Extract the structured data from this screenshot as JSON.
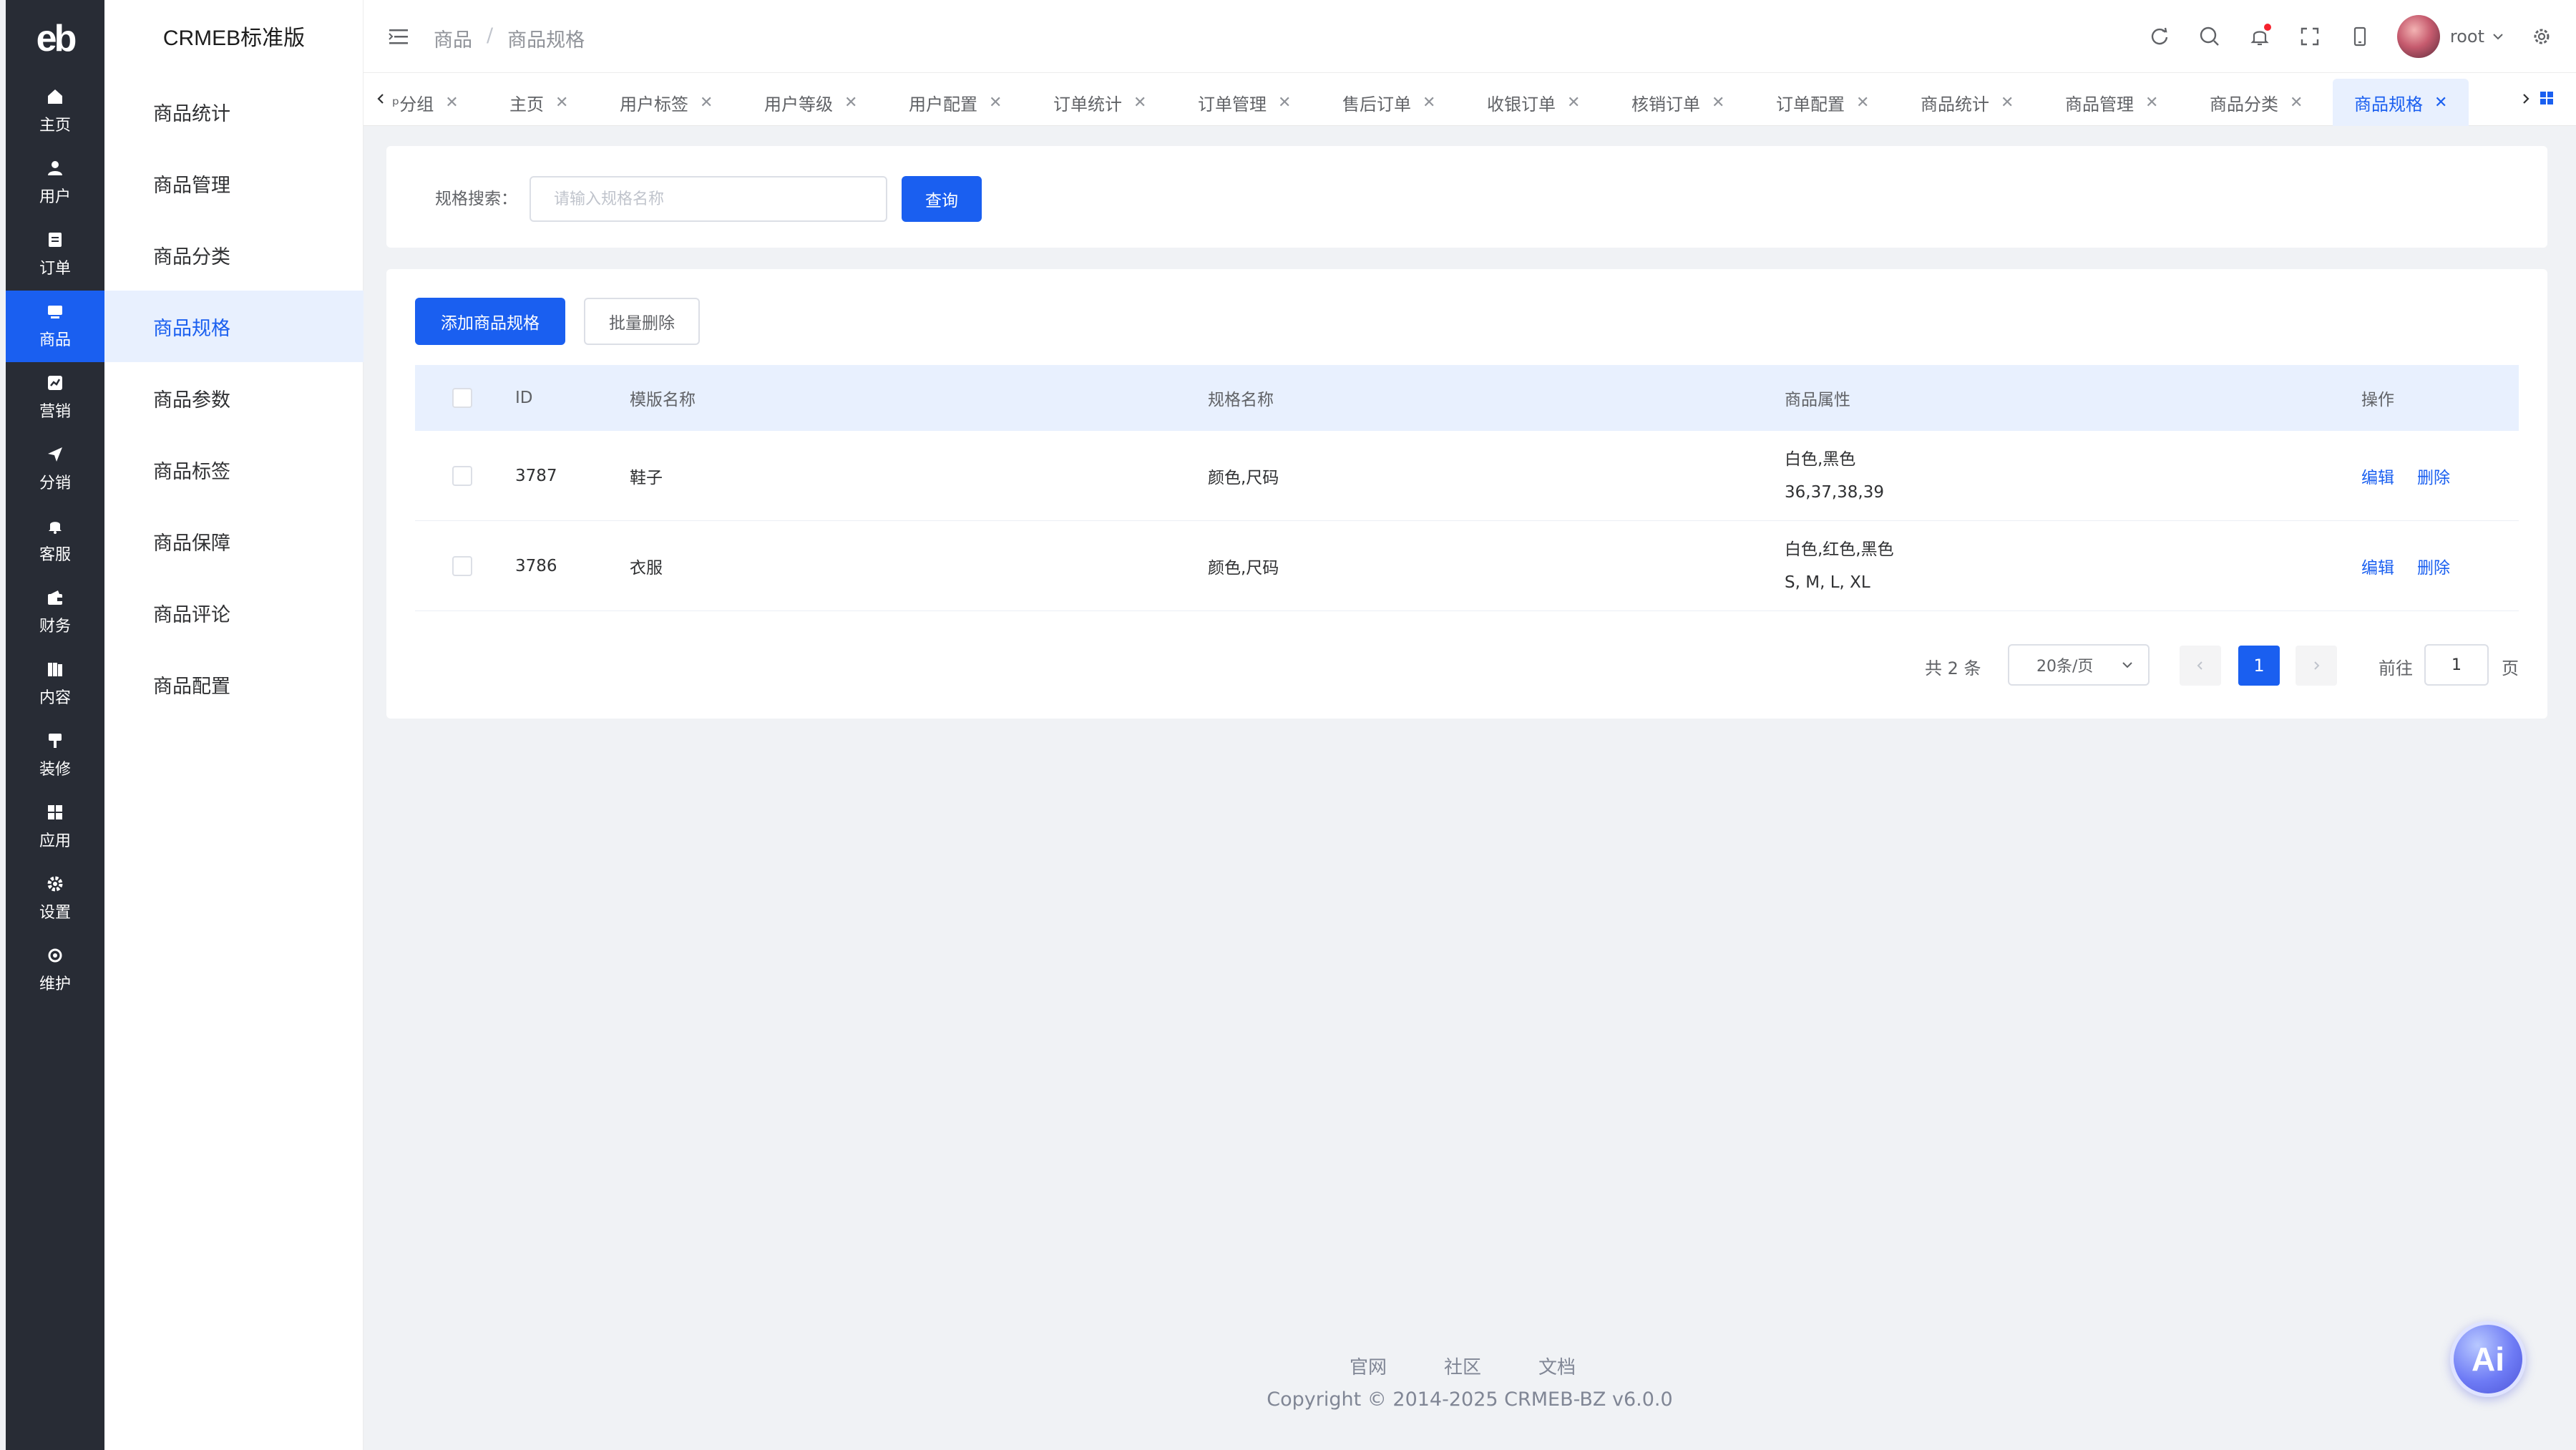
{
  "brand": {
    "logo_text": "eb",
    "title": "CRMEB标准版"
  },
  "rail": {
    "items": [
      {
        "label": "主页",
        "icon": "home-icon"
      },
      {
        "label": "用户",
        "icon": "user-icon"
      },
      {
        "label": "订单",
        "icon": "order-icon"
      },
      {
        "label": "商品",
        "icon": "product-icon",
        "active": true
      },
      {
        "label": "营销",
        "icon": "marketing-icon"
      },
      {
        "label": "分销",
        "icon": "distribution-icon"
      },
      {
        "label": "客服",
        "icon": "service-icon"
      },
      {
        "label": "财务",
        "icon": "finance-icon"
      },
      {
        "label": "内容",
        "icon": "content-icon"
      },
      {
        "label": "装修",
        "icon": "decorate-icon"
      },
      {
        "label": "应用",
        "icon": "apps-icon"
      },
      {
        "label": "设置",
        "icon": "settings-icon"
      },
      {
        "label": "维护",
        "icon": "maintain-icon"
      }
    ]
  },
  "subnav": {
    "items": [
      {
        "label": "商品统计"
      },
      {
        "label": "商品管理"
      },
      {
        "label": "商品分类"
      },
      {
        "label": "商品规格",
        "active": true
      },
      {
        "label": "商品参数"
      },
      {
        "label": "商品标签"
      },
      {
        "label": "商品保障"
      },
      {
        "label": "商品评论"
      },
      {
        "label": "商品配置"
      }
    ]
  },
  "header": {
    "breadcrumb": [
      "商品",
      "商品规格"
    ],
    "breadcrumb_sep": "/",
    "username": "root"
  },
  "tabs": [
    {
      "label": "ᵖ分组"
    },
    {
      "label": "主页"
    },
    {
      "label": "用户标签"
    },
    {
      "label": "用户等级"
    },
    {
      "label": "用户配置"
    },
    {
      "label": "订单统计"
    },
    {
      "label": "订单管理"
    },
    {
      "label": "售后订单"
    },
    {
      "label": "收银订单"
    },
    {
      "label": "核销订单"
    },
    {
      "label": "订单配置"
    },
    {
      "label": "商品统计"
    },
    {
      "label": "商品管理"
    },
    {
      "label": "商品分类"
    },
    {
      "label": "商品规格",
      "active": true
    }
  ],
  "search": {
    "label": "规格搜索：",
    "placeholder": "请输入规格名称",
    "value": "",
    "button": "查询"
  },
  "toolbar": {
    "add": "添加商品规格",
    "batch_delete": "批量删除"
  },
  "table": {
    "columns": [
      "ID",
      "模版名称",
      "规格名称",
      "商品属性",
      "操作"
    ],
    "rows": [
      {
        "id": "3787",
        "template": "鞋子",
        "spec": "颜色,尺码",
        "attr_line1": "白色,黑色",
        "attr_line2": "36,37,38,39",
        "edit": "编辑",
        "delete": "删除"
      },
      {
        "id": "3786",
        "template": "衣服",
        "spec": "颜色,尺码",
        "attr_line1": "白色,红色,黑色",
        "attr_line2": "S, M, L, XL",
        "edit": "编辑",
        "delete": "删除"
      }
    ]
  },
  "pagination": {
    "total": "共 2 条",
    "page_size": "20条/页",
    "current": "1",
    "goto_label": "前往",
    "goto_value": "1",
    "page_suffix": "页"
  },
  "footer": {
    "links": [
      "官网",
      "社区",
      "文档"
    ],
    "copyright": "Copyright © 2014-2025 CRMEB-BZ v6.0.0"
  },
  "ai_button": "Ai",
  "colors": {
    "primary": "#1a5ff0",
    "rail_bg": "#282c35",
    "active_bg": "#e8f0fe"
  }
}
